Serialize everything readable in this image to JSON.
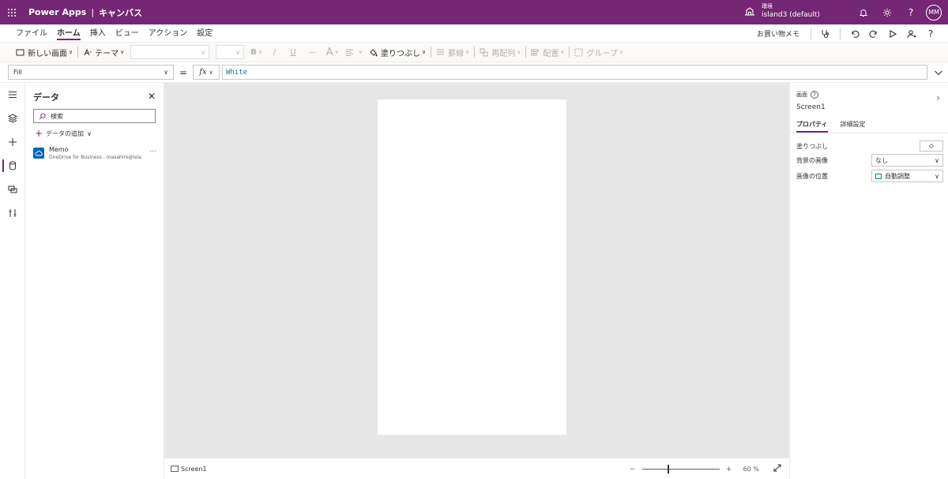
{
  "topbar": {
    "app_name": "Power Apps",
    "separator": "|",
    "mode": "キャンバス",
    "env_label": "環境",
    "env_name": "island3 (default)",
    "avatar_initials": "MM",
    "help_glyph": "?"
  },
  "menu": {
    "items": [
      "ファイル",
      "ホーム",
      "挿入",
      "ビュー",
      "アクション",
      "設定"
    ],
    "active": "ホーム",
    "memo": "お買い物メモ",
    "help_glyph": "?"
  },
  "toolbar": {
    "new_screen": "新しい画面",
    "theme": "テーマ",
    "bold": "B",
    "italic": "/",
    "underline": "U",
    "strike": "—",
    "font_color": "A",
    "fill": "塗りつぶし",
    "border": "罫線",
    "reorder": "再配列",
    "align": "配置",
    "group": "グループ"
  },
  "formula": {
    "property": "Fill",
    "equals": "=",
    "fx": "fx",
    "value": "White"
  },
  "datapanel": {
    "title": "データ",
    "search_placeholder": "検索",
    "add_data": "データの追加",
    "source_name": "Memo",
    "source_sub": "OneDrive for Business - masahiro@isla...",
    "more": "..."
  },
  "status": {
    "screen_name": "Screen1",
    "zoom_minus": "−",
    "zoom_plus": "+",
    "zoom_pct": "60 %",
    "zoom_level": 0.6
  },
  "props": {
    "kind": "画面",
    "help": "?",
    "name": "Screen1",
    "tabs": [
      "プロパティ",
      "詳細設定"
    ],
    "fill_label": "塗りつぶし",
    "bg_image_label": "背景の画像",
    "bg_image_value": "なし",
    "image_pos_label": "画像の位置",
    "image_pos_value": "自動調整"
  },
  "colors": {
    "brand": "#742774",
    "formula_text": "#0f7a8a",
    "canvas_bg": "#e6e6e6",
    "datasource_blue": "#0364b8"
  }
}
